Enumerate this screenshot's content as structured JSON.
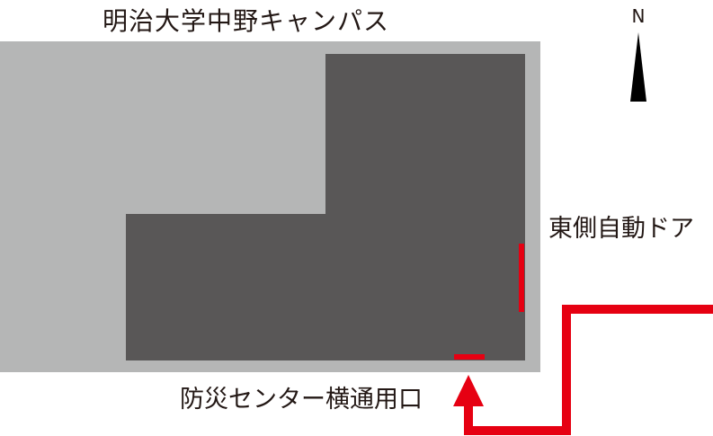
{
  "map": {
    "title": "明治大学中野キャンパス",
    "compass": {
      "label": "N"
    },
    "entrances": {
      "east": {
        "label": "東側自動ドア"
      },
      "south": {
        "label": "防災センター横通用口"
      }
    },
    "colors": {
      "campus_ground": "#b5b6b6",
      "building": "#595757",
      "route": "#e60012",
      "text": "#231815"
    },
    "icons": {
      "compass": "north-arrow-icon",
      "route": "route-arrow-icon"
    }
  }
}
